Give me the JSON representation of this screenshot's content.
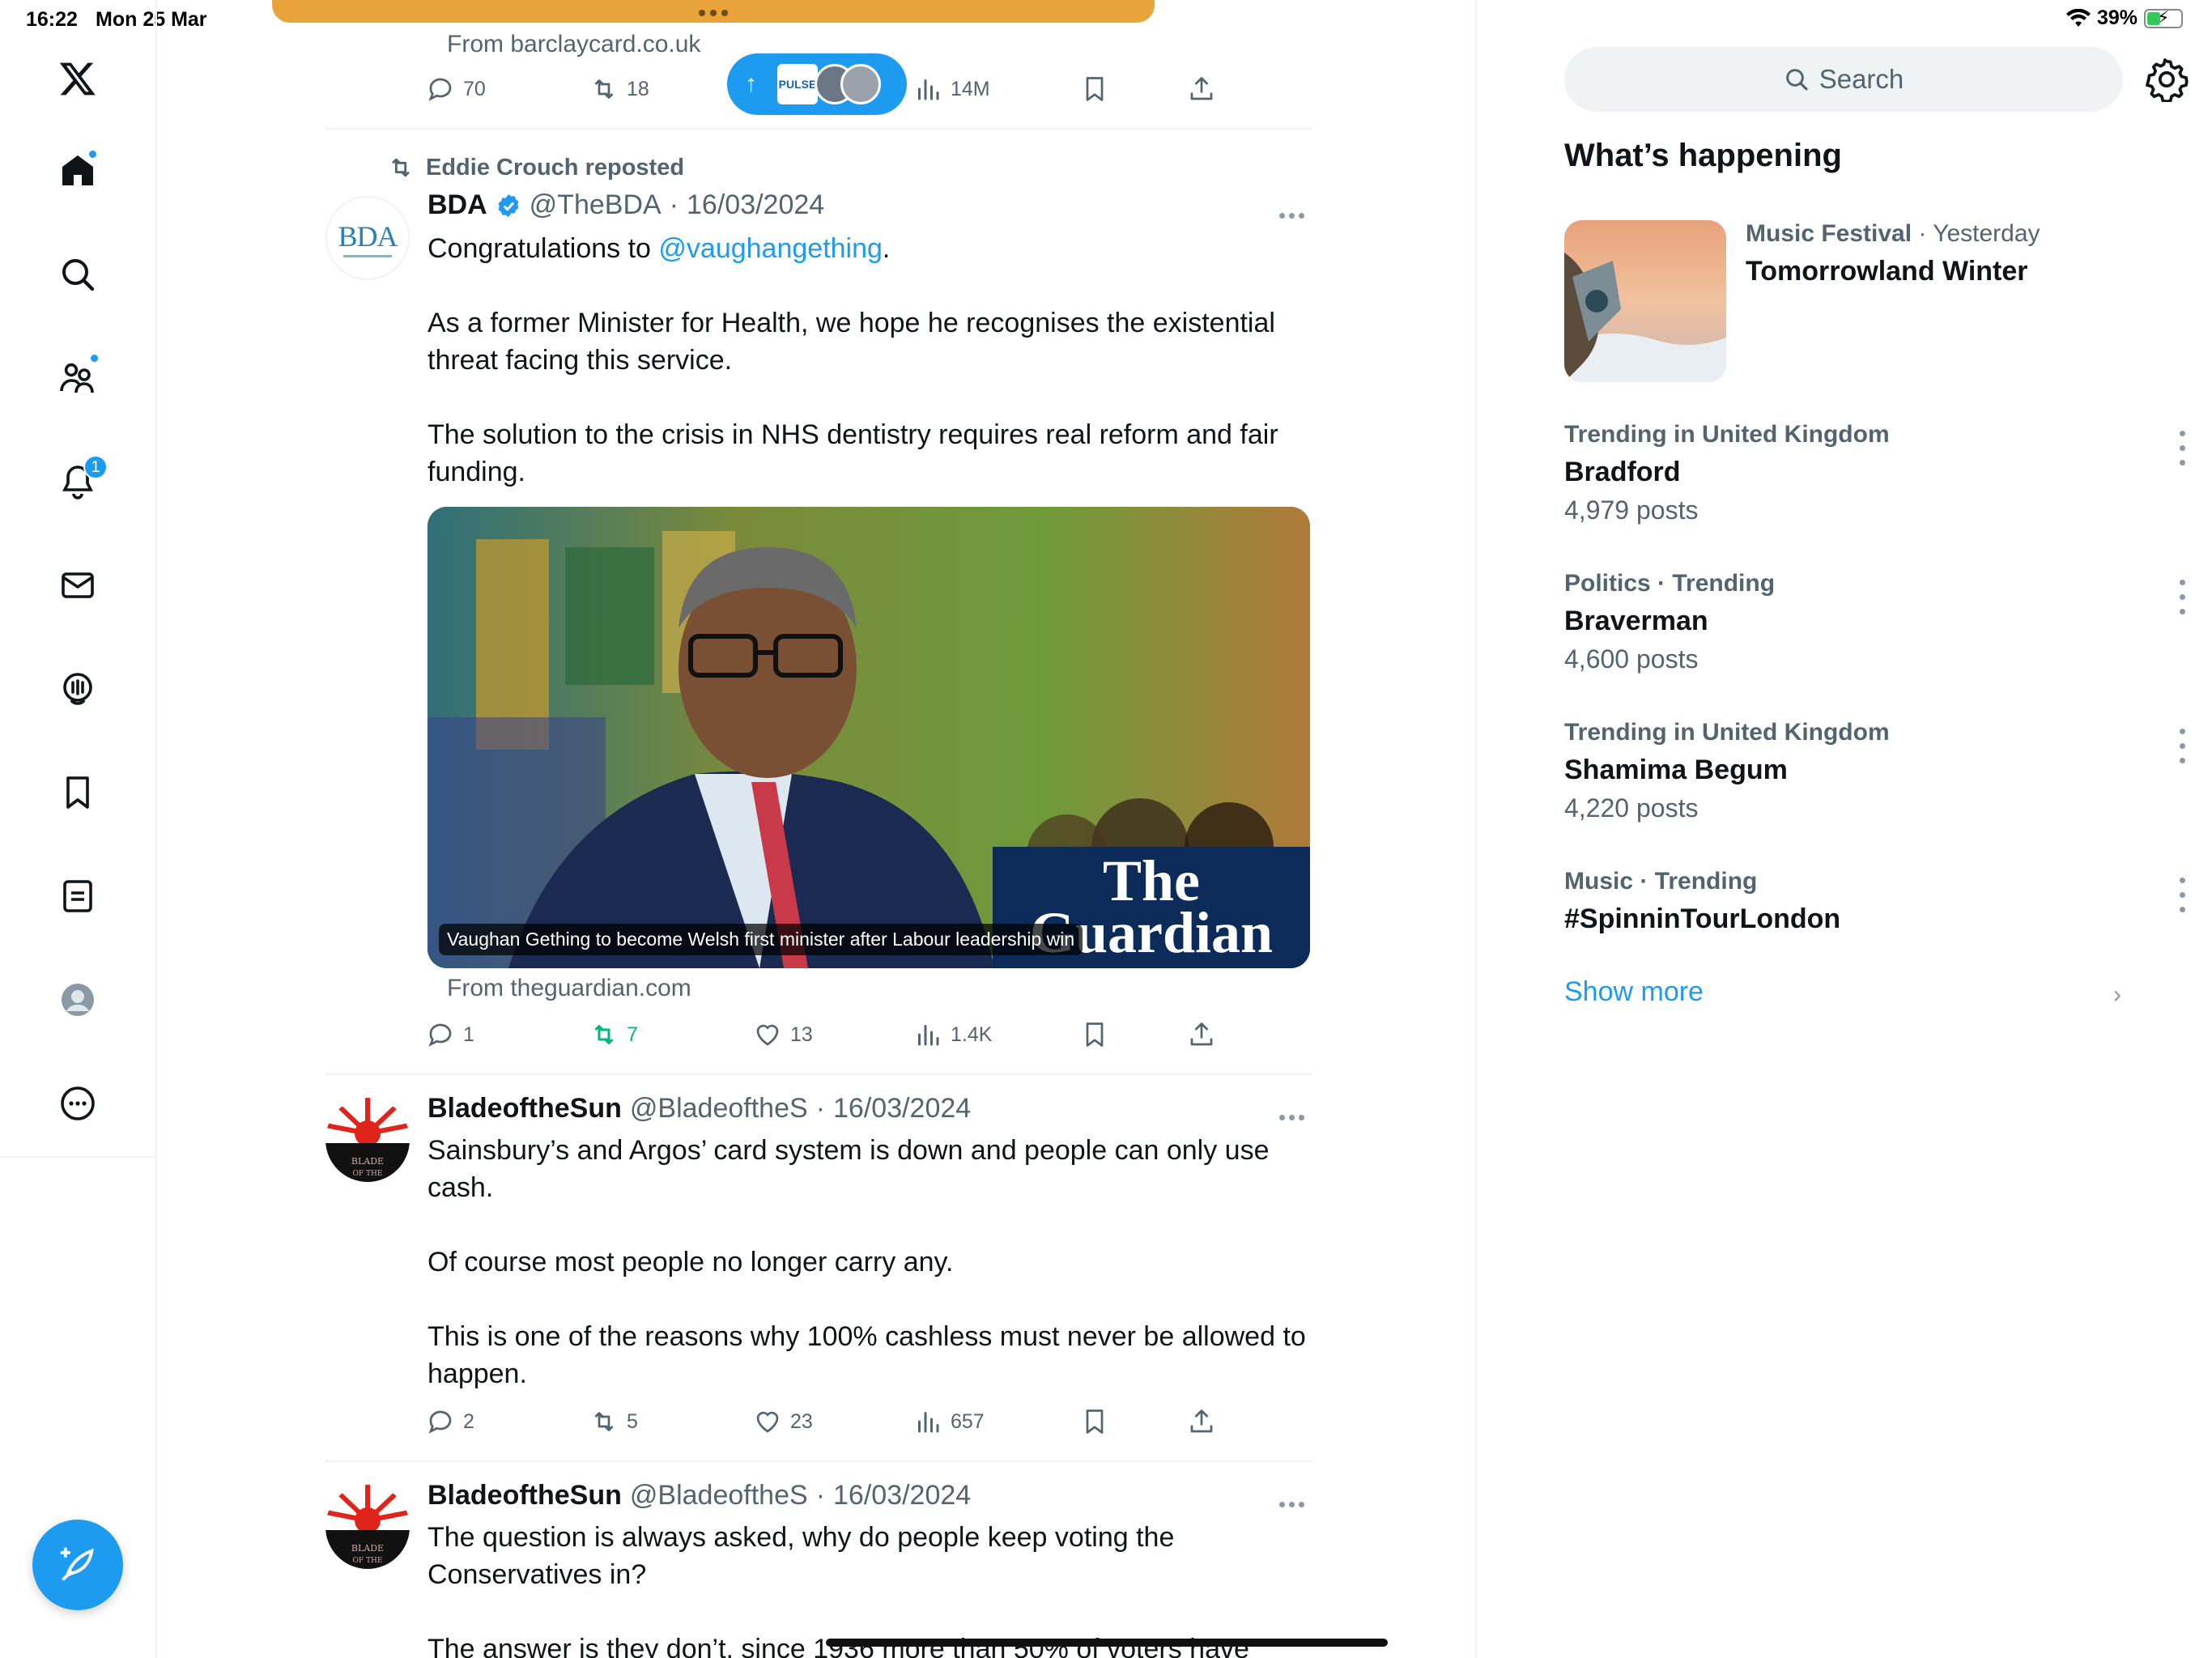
{
  "status_bar": {
    "time": "16:22",
    "date": "Mon 25 Mar",
    "battery": "39%"
  },
  "nav": {
    "notifications_badge": "1",
    "items": [
      "x-logo",
      "home",
      "search",
      "communities",
      "notifications",
      "messages",
      "grok",
      "bookmarks",
      "lists",
      "profile",
      "more"
    ]
  },
  "timeline": {
    "top_card": {
      "from": "From barclaycard.co.uk",
      "replies": "70",
      "reposts": "18",
      "views": "14M"
    },
    "pulse": {
      "label": "PULSE"
    },
    "tweets": [
      {
        "repost_by": "Eddie Crouch reposted",
        "name": "BDA",
        "handle": "@TheBDA",
        "date": "16/03/2024",
        "avatar_text": "BDA",
        "text_prefix": "Congratulations to ",
        "mention": "@vaughangething",
        "text_suffix": ".",
        "para2": "As a former Minister for Health, we hope he recognises the existential threat facing this service.",
        "para3": "The solution to the crisis in NHS dentistry requires real reform and fair funding.",
        "media_caption": "Vaughan Gething to become Welsh first minister after Labour leadership win",
        "media_brand": "The Guardian",
        "from": "From theguardian.com",
        "replies": "1",
        "reposts": "7",
        "likes": "13",
        "views": "1.4K"
      },
      {
        "name": "BladeoftheSun",
        "handle": "@BladeoftheS",
        "date": "16/03/2024",
        "para1": "Sainsbury’s and Argos’ card system is down and people can only use cash.",
        "para2": "Of course most people no longer carry any.",
        "para3": "This  is one of the reasons why 100% cashless must never be allowed to happen.",
        "replies": "2",
        "reposts": "5",
        "likes": "23",
        "views": "657"
      },
      {
        "name": "BladeoftheSun",
        "handle": "@BladeoftheS",
        "date": "16/03/2024",
        "para1": "The question is always asked, why do people keep voting the Conservatives in?",
        "para2": "The answer is they don’t, since 1936 more than 50% of voters have"
      }
    ]
  },
  "sidebar": {
    "search_placeholder": "Search",
    "section_title": "What’s happening",
    "feature": {
      "category": "Music Festival",
      "when": "Yesterday",
      "title": "Tomorrowland Winter"
    },
    "trends": [
      {
        "context": "Trending in United Kingdom",
        "topic": "Bradford",
        "count": "4,979 posts"
      },
      {
        "context": "Politics · Trending",
        "topic": "Braverman",
        "count": "4,600 posts"
      },
      {
        "context": "Trending in United Kingdom",
        "topic": "Shamima Begum",
        "count": "4,220 posts"
      },
      {
        "context": "Music · Trending",
        "topic": "#SpinninTourLondon",
        "count": ""
      }
    ],
    "show_more": "Show more"
  },
  "colors": {
    "accent": "#1d9bf0",
    "repost_green": "#00ba7c",
    "muted": "#536471"
  }
}
